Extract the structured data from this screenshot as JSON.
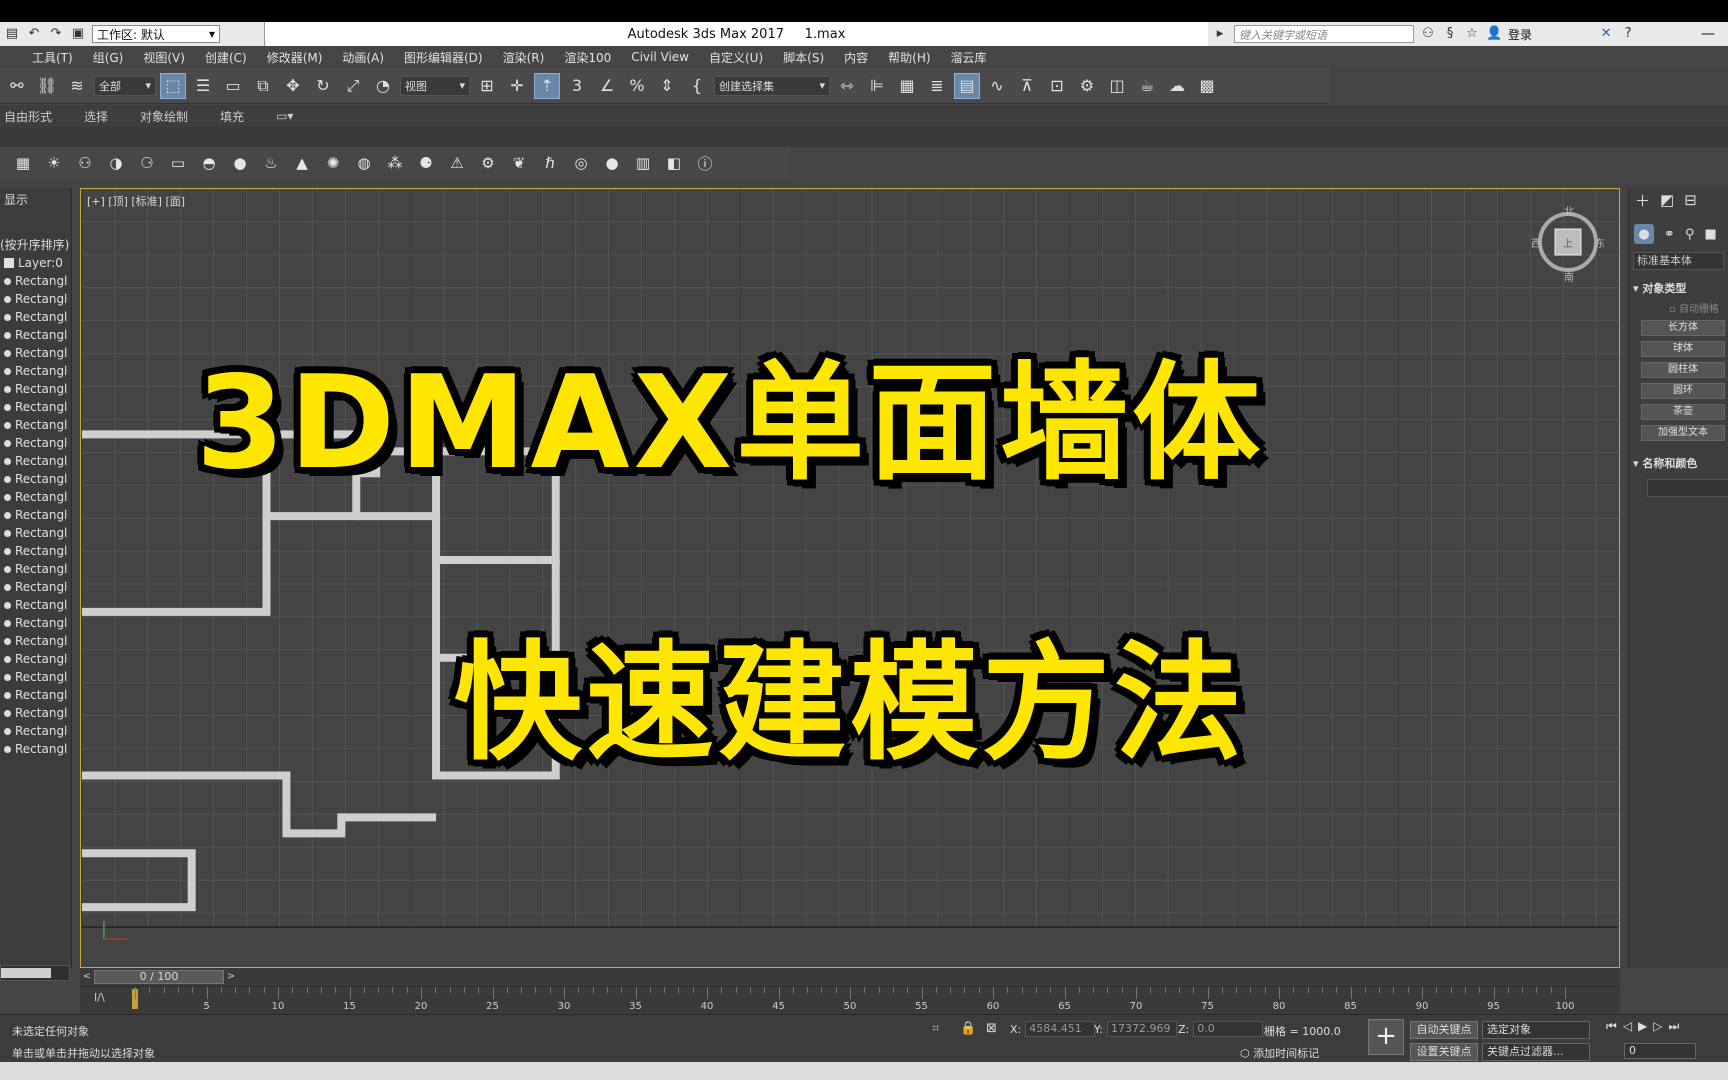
{
  "app": {
    "title": "Autodesk 3ds Max 2017",
    "file": "1.max",
    "workspace_label": "工作区: 默认",
    "search_placeholder": "键入关键字或短语",
    "login": "登录"
  },
  "menu": [
    "工具(T)",
    "组(G)",
    "视图(V)",
    "创建(C)",
    "修改器(M)",
    "动画(A)",
    "图形编辑器(D)",
    "渲染(R)",
    "渲染100",
    "Civil View",
    "自定义(U)",
    "脚本(S)",
    "内容",
    "帮助(H)",
    "溜云库"
  ],
  "toolbar": {
    "filter": "全部",
    "ref_coord": "视图",
    "selection_set": "创建选择集"
  },
  "ribbon": [
    "自由形式",
    "选择",
    "对象绘制",
    "填充"
  ],
  "explorer": {
    "header": "显示",
    "sort_label": "(按升序排序)",
    "layer": "Layer:0",
    "item_label": "Rectangl",
    "item_count": 27
  },
  "viewport": {
    "label": "[+] [顶] [标准] [面]",
    "viewcube": {
      "top": "上",
      "north": "北",
      "south": "南",
      "west": "西",
      "east": "东"
    },
    "headline_1": "3DMAX单面墙体",
    "headline_2": "快速建模方法",
    "headline_color": "#ffe600"
  },
  "command_panel": {
    "category": "标准基本体",
    "section_object_type": "对象类型",
    "autogrid": "自动栅格",
    "buttons": [
      "长方体",
      "球体",
      "圆柱体",
      "圆环",
      "茶壶",
      "加强型文本"
    ],
    "section_name_color": "名称和颜色"
  },
  "timeline": {
    "slider": "0 / 100",
    "ticks": [
      "5",
      "10",
      "15",
      "20",
      "25",
      "30",
      "35",
      "40",
      "45",
      "50",
      "55",
      "60",
      "65",
      "70",
      "75",
      "80",
      "85",
      "90",
      "95",
      "100"
    ]
  },
  "status": {
    "line1": "未选定任何对象",
    "line2": "单击或单击并拖动以选择对象",
    "x_label": "X:",
    "x": "4584.451",
    "y_label": "Y:",
    "y": "17372.969",
    "z_label": "Z:",
    "z": "0.0",
    "grid": "栅格 = 1000.0",
    "add_time_tag": "添加时间标记",
    "auto_key": "自动关键点",
    "set_key": "设置关键点",
    "selected_object": "选定对象",
    "key_filters": "关键点过滤器...",
    "frame": "0"
  }
}
